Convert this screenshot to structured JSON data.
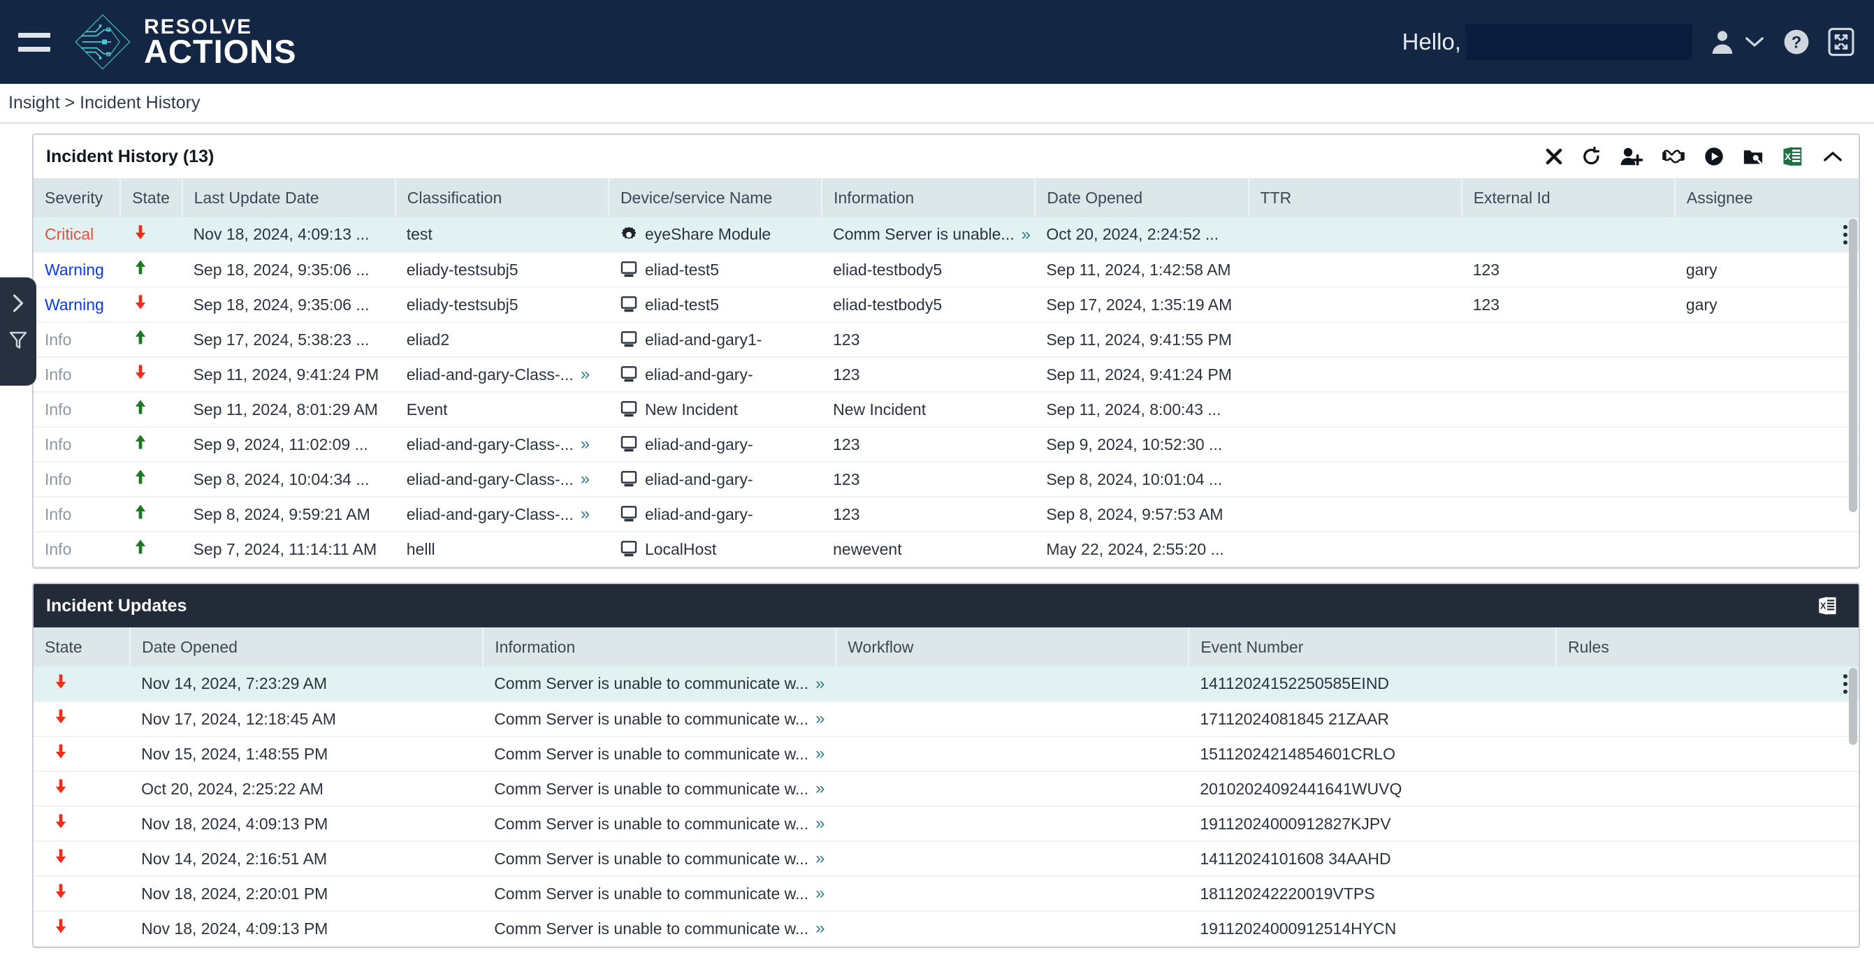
{
  "header": {
    "logo_line1": "RESOLVE",
    "logo_line2": "ACTIONS",
    "greeting": "Hello,",
    "menu_icon": "hamburger-icon",
    "user_icon": "user-icon",
    "chevron_icon": "chevron-down-icon",
    "help_icon": "help-icon",
    "fullscreen_icon": "fullscreen-icon",
    "brand_bg": "#132644",
    "redact_bg": "#0b1c3d"
  },
  "breadcrumb": {
    "text": "Insight > Incident History"
  },
  "rail": {
    "expand_icon": "chevron-right-icon",
    "filter_icon": "filter-icon"
  },
  "incident_history": {
    "title": "Incident History (13)",
    "tools": [
      {
        "name": "close-icon",
        "label": "Close"
      },
      {
        "name": "refresh-icon",
        "label": "Refresh"
      },
      {
        "name": "add-user-icon",
        "label": "Assign"
      },
      {
        "name": "handshake-icon",
        "label": "Handover"
      },
      {
        "name": "play-icon",
        "label": "Run"
      },
      {
        "name": "search-folder-icon",
        "label": "Investigate"
      },
      {
        "name": "excel-export-icon",
        "label": "Export to Excel"
      },
      {
        "name": "collapse-icon",
        "label": "Collapse"
      }
    ],
    "columns": [
      "Severity",
      "State",
      "Last Update Date",
      "Classification",
      "Device/service Name",
      "Information",
      "Date Opened",
      "TTR",
      "External Id",
      "Assignee"
    ],
    "rows": [
      {
        "severity": "Critical",
        "severity_class": "critical",
        "state": "down",
        "last_update": "Nov 18, 2024, 4:09:13 ...",
        "classification": "test",
        "classification_more": false,
        "device_icon": "gear-icon",
        "device": "eyeShare Module",
        "information": "Comm Server is unable...",
        "information_more": true,
        "date_opened": "Oct 20, 2024, 2:24:52 ...",
        "ttr": "",
        "external_id": "",
        "assignee": "",
        "selected": true,
        "has_kebab": true
      },
      {
        "severity": "Warning",
        "severity_class": "warning",
        "state": "up",
        "last_update": "Sep 18, 2024, 9:35:06 ...",
        "classification": "eliady-testsubj5",
        "classification_more": false,
        "device_icon": "monitor-icon",
        "device": "eliad-test5",
        "information": "eliad-testbody5",
        "information_more": false,
        "date_opened": "Sep 11, 2024, 1:42:58 AM",
        "ttr": "",
        "external_id": "123",
        "assignee": "gary",
        "selected": false,
        "has_kebab": false
      },
      {
        "severity": "Warning",
        "severity_class": "warning",
        "state": "down",
        "last_update": "Sep 18, 2024, 9:35:06 ...",
        "classification": "eliady-testsubj5",
        "classification_more": false,
        "device_icon": "monitor-icon",
        "device": "eliad-test5",
        "information": "eliad-testbody5",
        "information_more": false,
        "date_opened": "Sep 17, 2024, 1:35:19 AM",
        "ttr": "",
        "external_id": "123",
        "assignee": "gary",
        "selected": false,
        "has_kebab": false
      },
      {
        "severity": "Info",
        "severity_class": "info",
        "state": "up",
        "last_update": "Sep 17, 2024, 5:38:23 ...",
        "classification": "eliad2",
        "classification_more": false,
        "device_icon": "monitor-icon",
        "device": "eliad-and-gary1-",
        "information": "123",
        "information_more": false,
        "date_opened": "Sep 11, 2024, 9:41:55 PM",
        "ttr": "",
        "external_id": "",
        "assignee": "",
        "selected": false,
        "has_kebab": false
      },
      {
        "severity": "Info",
        "severity_class": "info",
        "state": "down",
        "last_update": "Sep 11, 2024, 9:41:24 PM",
        "classification": "eliad-and-gary-Class-...",
        "classification_more": true,
        "device_icon": "monitor-icon",
        "device": "eliad-and-gary-",
        "information": "123",
        "information_more": false,
        "date_opened": "Sep 11, 2024, 9:41:24 PM",
        "ttr": "",
        "external_id": "",
        "assignee": "",
        "selected": false,
        "has_kebab": false
      },
      {
        "severity": "Info",
        "severity_class": "info",
        "state": "up",
        "last_update": "Sep 11, 2024, 8:01:29 AM",
        "classification": "Event",
        "classification_more": false,
        "device_icon": "monitor-icon",
        "device": "New Incident",
        "information": "New Incident",
        "information_more": false,
        "date_opened": "Sep 11, 2024, 8:00:43 ...",
        "ttr": "",
        "external_id": "",
        "assignee": "",
        "selected": false,
        "has_kebab": false
      },
      {
        "severity": "Info",
        "severity_class": "info",
        "state": "up",
        "last_update": "Sep 9, 2024, 11:02:09 ...",
        "classification": "eliad-and-gary-Class-...",
        "classification_more": true,
        "device_icon": "monitor-icon",
        "device": "eliad-and-gary-",
        "information": "123",
        "information_more": false,
        "date_opened": "Sep 9, 2024, 10:52:30 ...",
        "ttr": "",
        "external_id": "",
        "assignee": "",
        "selected": false,
        "has_kebab": false
      },
      {
        "severity": "Info",
        "severity_class": "info",
        "state": "up",
        "last_update": "Sep 8, 2024, 10:04:34 ...",
        "classification": "eliad-and-gary-Class-...",
        "classification_more": true,
        "device_icon": "monitor-icon",
        "device": "eliad-and-gary-",
        "information": "123",
        "information_more": false,
        "date_opened": "Sep 8, 2024, 10:01:04 ...",
        "ttr": "",
        "external_id": "",
        "assignee": "",
        "selected": false,
        "has_kebab": false
      },
      {
        "severity": "Info",
        "severity_class": "info",
        "state": "up",
        "last_update": "Sep 8, 2024, 9:59:21 AM",
        "classification": "eliad-and-gary-Class-...",
        "classification_more": true,
        "device_icon": "monitor-icon",
        "device": "eliad-and-gary-",
        "information": "123",
        "information_more": false,
        "date_opened": "Sep 8, 2024, 9:57:53 AM",
        "ttr": "",
        "external_id": "",
        "assignee": "",
        "selected": false,
        "has_kebab": false
      },
      {
        "severity": "Info",
        "severity_class": "info",
        "state": "up",
        "last_update": "Sep 7, 2024, 11:14:11 AM",
        "classification": "helll",
        "classification_more": false,
        "device_icon": "monitor-icon",
        "device": "LocalHost",
        "information": "newevent",
        "information_more": false,
        "date_opened": "May 22, 2024, 2:55:20 ...",
        "ttr": "",
        "external_id": "",
        "assignee": "",
        "selected": false,
        "has_kebab": false
      }
    ]
  },
  "incident_updates": {
    "title": "Incident Updates",
    "export_icon": "excel-export-icon",
    "columns": [
      "State",
      "Date Opened",
      "Information",
      "Workflow",
      "Event Number",
      "Rules"
    ],
    "rows": [
      {
        "state": "down",
        "date_opened": "Nov 14, 2024, 7:23:29 AM",
        "information": "Comm Server is unable to communicate w...",
        "information_more": true,
        "workflow": "",
        "event_number": "14112024152250585EIND",
        "rules": "",
        "selected": true,
        "has_kebab": true
      },
      {
        "state": "down",
        "date_opened": "Nov 17, 2024, 12:18:45 AM",
        "information": "Comm Server is unable to communicate w...",
        "information_more": true,
        "workflow": "",
        "event_number": "17112024081845 21ZAAR",
        "rules": "",
        "selected": false,
        "has_kebab": false
      },
      {
        "state": "down",
        "date_opened": "Nov 15, 2024, 1:48:55 PM",
        "information": "Comm Server is unable to communicate w...",
        "information_more": true,
        "workflow": "",
        "event_number": "15112024214854601CRLO",
        "rules": "",
        "selected": false,
        "has_kebab": false
      },
      {
        "state": "down",
        "date_opened": "Oct 20, 2024, 2:25:22 AM",
        "information": "Comm Server is unable to communicate w...",
        "information_more": true,
        "workflow": "",
        "event_number": "20102024092441641WUVQ",
        "rules": "",
        "selected": false,
        "has_kebab": false
      },
      {
        "state": "down",
        "date_opened": "Nov 18, 2024, 4:09:13 PM",
        "information": "Comm Server is unable to communicate w...",
        "information_more": true,
        "workflow": "",
        "event_number": "19112024000912827KJPV",
        "rules": "",
        "selected": false,
        "has_kebab": false
      },
      {
        "state": "down",
        "date_opened": "Nov 14, 2024, 2:16:51 AM",
        "information": "Comm Server is unable to communicate w...",
        "information_more": true,
        "workflow": "",
        "event_number": "14112024101608 34AAHD",
        "rules": "",
        "selected": false,
        "has_kebab": false
      },
      {
        "state": "down",
        "date_opened": "Nov 18, 2024, 2:20:01 PM",
        "information": "Comm Server is unable to communicate w...",
        "information_more": true,
        "workflow": "",
        "event_number": "181120242220019VTPS",
        "rules": "",
        "selected": false,
        "has_kebab": false
      },
      {
        "state": "down",
        "date_opened": "Nov 18, 2024, 4:09:13 PM",
        "information": "Comm Server is unable to communicate w...",
        "information_more": true,
        "workflow": "",
        "event_number": "19112024000912514HYCN",
        "rules": "",
        "selected": false,
        "has_kebab": false
      }
    ]
  }
}
